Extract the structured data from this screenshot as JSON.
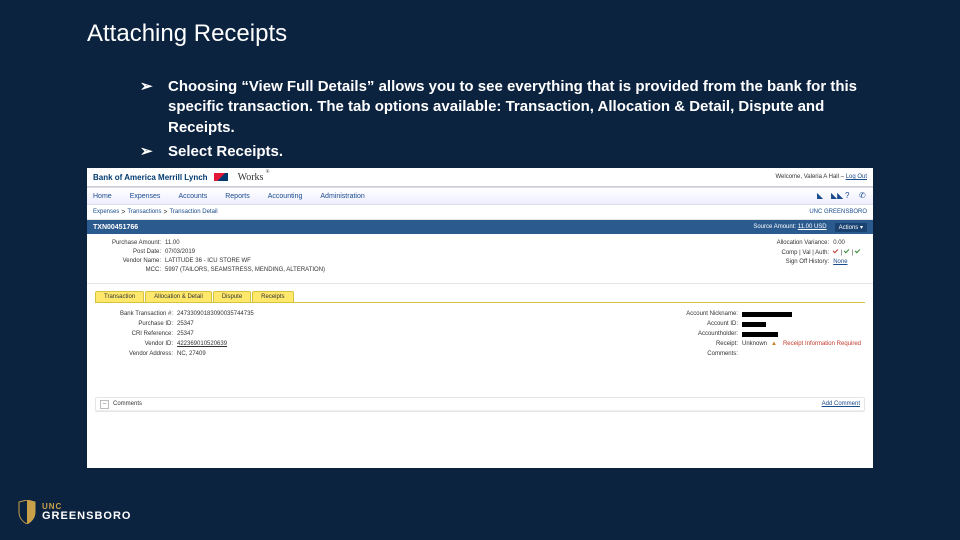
{
  "slide": {
    "title": "Attaching Receipts",
    "bullets": [
      "Choosing “View Full Details” allows you to see everything that is provided from the bank for this specific transaction.  The tab options available: Transaction, Allocation & Detail, Dispute and Receipts.",
      "Select Receipts."
    ]
  },
  "app": {
    "header": {
      "bank": "Bank of America\nMerrill Lynch",
      "product": "Works",
      "welcome_prefix": "Welcome, ",
      "user": "Valeria A Hall",
      "logout": "Log Out"
    },
    "nav": [
      "Home",
      "Expenses",
      "Accounts",
      "Reports",
      "Accounting",
      "Administration"
    ],
    "breadcrumb": [
      "Expenses",
      "Transactions",
      "Transaction Detail"
    ],
    "org": "UNC GREENSBORO",
    "txn": {
      "id": "TXN00451766",
      "source_label": "Source Amount:",
      "source_amount": "11.00 USD",
      "actions": "Actions"
    },
    "summary": {
      "left": [
        {
          "label": "Purchase Amount:",
          "value": "11.00"
        },
        {
          "label": "Post Date:",
          "value": "07/03/2019"
        },
        {
          "label": "Vendor Name:",
          "value": "LATITUDE 36 - ICU STORE WF"
        },
        {
          "label": "MCC:",
          "value": "5997 (TAILORS, SEAMSTRESS, MENDING, ALTERATION)"
        }
      ],
      "right": [
        {
          "label": "Allocation Variance:",
          "value": "0.00"
        },
        {
          "label": "Comp | Val | Auth:",
          "value": "checks"
        },
        {
          "label": "Sign Off History:",
          "value": "None"
        }
      ]
    },
    "tabs": [
      "Transaction",
      "Allocation & Detail",
      "Dispute",
      "Receipts"
    ],
    "detail": {
      "left": [
        {
          "label": "Bank Transaction #:",
          "value": "24733090183090035744735"
        },
        {
          "label": "Purchase ID:",
          "value": "25347"
        },
        {
          "label": "CRI Reference:",
          "value": "25347"
        },
        {
          "label": "Vendor ID:",
          "value": "422369010520639"
        },
        {
          "label": "Vendor Address:",
          "value": "NC, 27409"
        }
      ],
      "right": [
        {
          "label": "Account Nickname:",
          "value": "[redacted]"
        },
        {
          "label": "Account ID:",
          "value": "[redacted]"
        },
        {
          "label": "Accountholder:",
          "value": "[redacted]"
        },
        {
          "label": "Receipt:",
          "value": "Unknown",
          "warning": "Receipt Information Required"
        },
        {
          "label": "Comments:",
          "value": ""
        }
      ]
    },
    "comments": {
      "heading": "Comments",
      "add": "Add Comment"
    }
  },
  "footer": {
    "line1": "UNC",
    "line2": "GREENSBORO"
  }
}
